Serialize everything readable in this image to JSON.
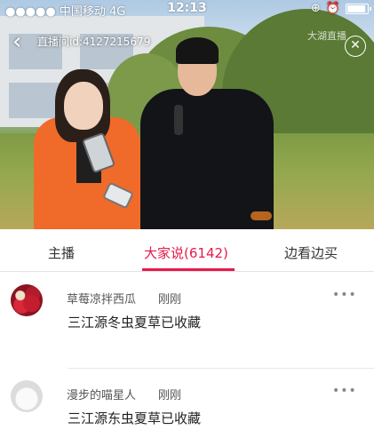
{
  "status_bar": {
    "carrier": "●●●●● 中国移动",
    "network": "4G",
    "time": "12:13"
  },
  "header": {
    "back_icon": "chevron-left-icon",
    "room_id": "直播间id:4127215679",
    "watermark": "大湖直播",
    "close_icon": "close-icon"
  },
  "tabs": [
    {
      "label": "主播",
      "active": false
    },
    {
      "label": "大家说(6142)",
      "active": true
    },
    {
      "label": "边看边买",
      "active": false
    }
  ],
  "comments": [
    {
      "name": "草莓凉拌西瓜",
      "time": "刚刚",
      "text": "三江源冬虫夏草已收藏",
      "avatar": "strawberry-avatar"
    },
    {
      "name": "漫步的喵星人",
      "time": "刚刚",
      "text": "三江源东虫夏草已收藏",
      "avatar": "cat-avatar"
    }
  ],
  "colors": {
    "accent": "#e8194a",
    "text": "#222222",
    "muted": "#555555"
  }
}
